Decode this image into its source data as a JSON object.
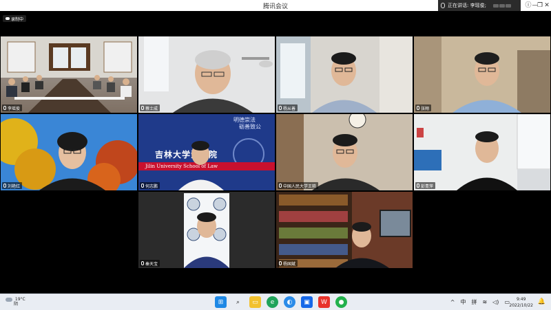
{
  "window": {
    "title": "腾讯会议",
    "speaking_label": "正在讲话: 李瑶俊;",
    "controls": [
      "ⓘ",
      "—",
      "❐",
      "✕"
    ]
  },
  "recording": {
    "label": "录制中"
  },
  "participants": [
    {
      "name": "李瑶俊",
      "scene": "meeting-room"
    },
    {
      "name": "蔡士成",
      "scene": "office-elder"
    },
    {
      "name": "杨从善",
      "scene": "office-window"
    },
    {
      "name": "张翔",
      "scene": "office-cafe"
    },
    {
      "name": "刘艳红",
      "scene": "autumn-trees"
    },
    {
      "name": "何志鹏",
      "scene": "law-school-banner"
    },
    {
      "name": "中国人民大学王轶",
      "scene": "office-clock"
    },
    {
      "name": "彭青萍",
      "scene": "modern-office"
    },
    {
      "name": "秦天宝",
      "scene": "university-logo-wall"
    },
    {
      "name": "杨国斌",
      "scene": "bookshelf"
    }
  ],
  "banner": {
    "slogan_lines": [
      "明德崇法",
      "砺善致公"
    ],
    "school_cn": "吉林大学法学院",
    "school_en": "Jilin University School of Law"
  },
  "taskbar": {
    "weather_temp": "19°C",
    "weather_desc": "阴",
    "apps": [
      "windows",
      "search",
      "file-explorer",
      "edge",
      "browser",
      "tencent-meeting",
      "wps",
      "wechat"
    ],
    "tray": [
      "^",
      "中",
      "拼",
      "wifi",
      "volume",
      "battery"
    ],
    "tray_text": {
      "ime": "中",
      "pinyin": "拼"
    },
    "time": "9:49",
    "date": "2022/10/22"
  },
  "colors": {
    "banner_blue": "#1f3a8a",
    "banner_red": "#c8102e",
    "taskbar_bg": "#e9edf3"
  }
}
